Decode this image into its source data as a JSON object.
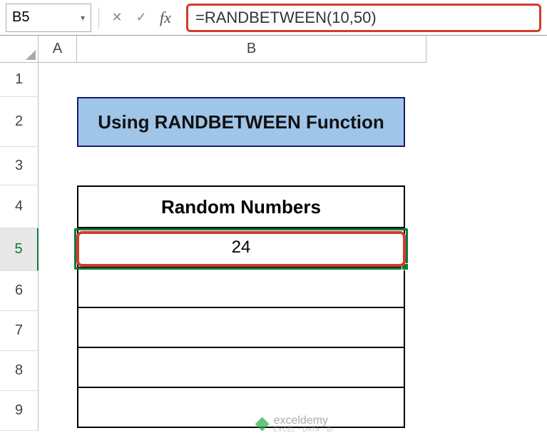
{
  "name_box": "B5",
  "formula": "=RANDBETWEEN(10,50)",
  "columns": {
    "a": "A",
    "b": "B"
  },
  "rows": {
    "r1": "1",
    "r2": "2",
    "r3": "3",
    "r4": "4",
    "r5": "5",
    "r6": "6",
    "r7": "7",
    "r8": "8",
    "r9": "9"
  },
  "title_cell": "Using RANDBETWEEN Function",
  "table": {
    "header": "Random Numbers",
    "rows": [
      "24",
      "",
      "",
      "",
      ""
    ]
  },
  "watermark": {
    "name": "exceldemy",
    "tagline": "EXCEL · DATA · BI"
  },
  "chart_data": {
    "type": "table",
    "title": "Random Numbers",
    "columns": [
      "Random Numbers"
    ],
    "rows": [
      [
        24
      ],
      [
        null
      ],
      [
        null
      ],
      [
        null
      ],
      [
        null
      ]
    ]
  }
}
